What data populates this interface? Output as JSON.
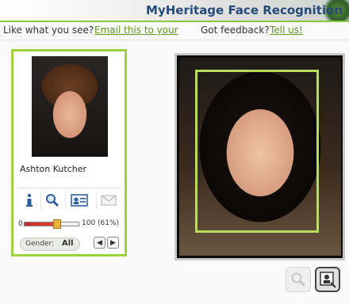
{
  "header": {
    "title": "MyHeritage Face Recognition"
  },
  "toolbar": {
    "like_text": "Like what you see?",
    "email_link": "Email this to your",
    "feedback_text": "Got feedback?",
    "feedback_link": "Tell us!"
  },
  "match": {
    "name": "Ashton Kutcher",
    "actions": [
      "info-icon",
      "search-icon",
      "profile-card-icon",
      "envelope-icon"
    ],
    "similarity": {
      "min": "0",
      "max_label": "100 (61%)",
      "value_percent": 61
    },
    "gender": {
      "label": "Gender:",
      "value": "All"
    },
    "nav": {
      "prev": "◀",
      "next": "▶"
    }
  },
  "colors": {
    "accent_green": "#9bd33c",
    "title_blue": "#244b7a",
    "link_green": "#5a9a1f",
    "face_box": "#b7dd5c"
  }
}
